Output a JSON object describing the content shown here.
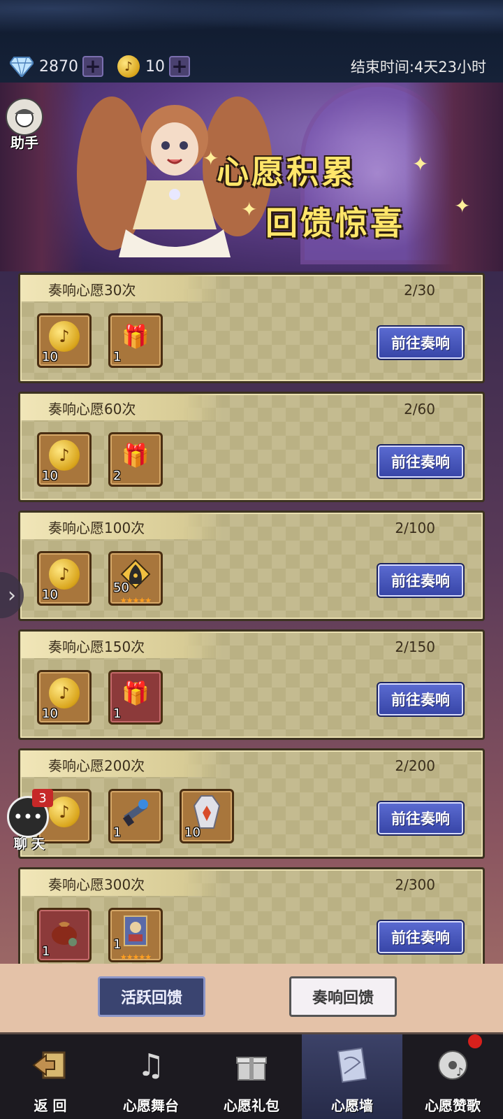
{
  "header": {
    "gems": "2870",
    "coins": "10",
    "end_time": "结束时间:4天23小时"
  },
  "assistant": {
    "label": "助手"
  },
  "banner": {
    "line1": "心愿积累",
    "line2": "回馈惊喜"
  },
  "tasks": [
    {
      "title": "奏响心愿30次",
      "progress": "2/30",
      "rewards": [
        {
          "icon": "music-coin-icon",
          "qty": "10"
        },
        {
          "icon": "gift-box-icon",
          "qty": "1"
        }
      ],
      "button": "前往奏响"
    },
    {
      "title": "奏响心愿60次",
      "progress": "2/60",
      "rewards": [
        {
          "icon": "music-coin-icon",
          "qty": "10"
        },
        {
          "icon": "gift-box-icon",
          "qty": "2"
        }
      ],
      "button": "前往奏响"
    },
    {
      "title": "奏响心愿100次",
      "progress": "2/100",
      "rewards": [
        {
          "icon": "music-coin-icon",
          "qty": "10"
        },
        {
          "icon": "hooded-figure-shard-icon",
          "qty": "50"
        }
      ],
      "button": "前往奏响"
    },
    {
      "title": "奏响心愿150次",
      "progress": "2/150",
      "rewards": [
        {
          "icon": "music-coin-icon",
          "qty": "10"
        },
        {
          "icon": "gift-box-icon",
          "qty": "1"
        }
      ],
      "button": "前往奏响"
    },
    {
      "title": "奏响心愿200次",
      "progress": "2/200",
      "rewards": [
        {
          "icon": "music-coin-icon",
          "qty": ""
        },
        {
          "icon": "weapon-icon",
          "qty": "1"
        },
        {
          "icon": "crystal-coffin-icon",
          "qty": "10"
        }
      ],
      "button": "前往奏响"
    },
    {
      "title": "奏响心愿300次",
      "progress": "2/300",
      "rewards": [
        {
          "icon": "money-bag-icon",
          "qty": "1"
        },
        {
          "icon": "card-icon",
          "qty": "1"
        }
      ],
      "button": "前往奏响"
    }
  ],
  "chat": {
    "label": "聊 天",
    "badge": "3"
  },
  "toggles": {
    "active_feedback": "活跃回馈",
    "play_feedback": "奏响回馈"
  },
  "nav": [
    {
      "label": "返 回",
      "icon": "back-icon"
    },
    {
      "label": "心愿舞台",
      "icon": "stage-icon"
    },
    {
      "label": "心愿礼包",
      "icon": "gift-icon"
    },
    {
      "label": "心愿墙",
      "icon": "wall-icon"
    },
    {
      "label": "心愿赞歌",
      "icon": "record-icon"
    }
  ],
  "colors": {
    "button_blue": "#3846a8",
    "panel_tan": "#c4bb90",
    "navbar": "#1c1a20"
  }
}
